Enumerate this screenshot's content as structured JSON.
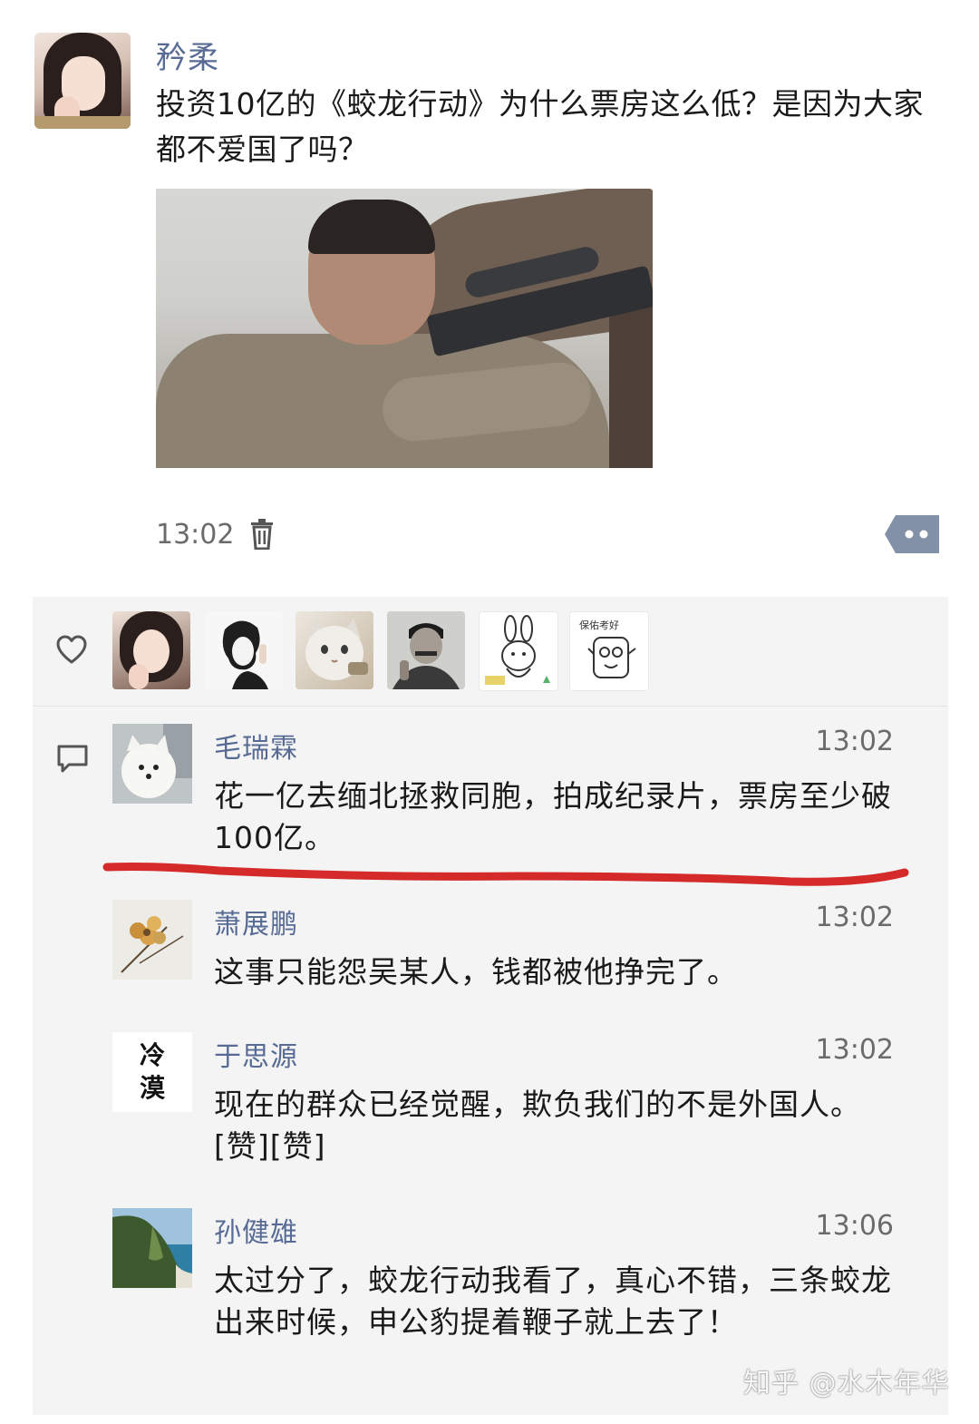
{
  "post": {
    "author": "矜柔",
    "text": "投资10亿的《蛟龙行动》为什么票房这么低？是因为大家都不爱国了吗？",
    "time": "13:02"
  },
  "icons": {
    "delete": "trash-icon",
    "more": "more-dots-icon",
    "like": "heart-icon",
    "comment": "comment-bubble-icon"
  },
  "likes": {
    "avatar_count_shown": 6,
    "liker5_text": "",
    "liker6_text": "保佑考好"
  },
  "comments": [
    {
      "name": "毛瑞霖",
      "time": "13:02",
      "text": "花一亿去缅北拯救同胞，拍成纪录片，票房至少破100亿。"
    },
    {
      "name": "萧展鹏",
      "time": "13:02",
      "text": "这事只能怨吴某人，钱都被他挣完了。"
    },
    {
      "name": "于思源",
      "time": "13:02",
      "avatar_text": "冷漠",
      "text": "现在的群众已经觉醒，欺负我们的不是外国人。[赞][赞]"
    },
    {
      "name": "孙健雄",
      "time": "13:06",
      "text": "太过分了，蛟龙行动我看了，真心不错，三条蛟龙出来时候，申公豹提着鞭子就上去了！"
    }
  ],
  "colors": {
    "name_blue": "#576b95",
    "panel_bg": "#f4f4f4",
    "highlight_red": "#d42a2a"
  },
  "watermark": "知乎 @水木年华"
}
